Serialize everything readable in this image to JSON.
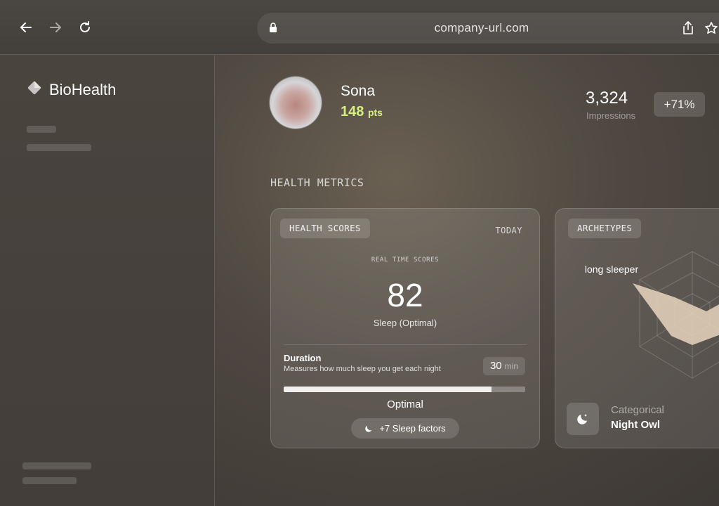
{
  "browser": {
    "url": "company-url.com",
    "icons": [
      "back-arrow-icon",
      "forward-arrow-icon",
      "reload-icon",
      "lock-icon",
      "share-icon",
      "bookmark-star-icon"
    ]
  },
  "sidebar": {
    "brand": "BioHealth",
    "logo_icon": "diamond-logo-icon"
  },
  "profile": {
    "name": "Sona",
    "points": "148",
    "points_unit": "pts",
    "impressions_value": "3,324",
    "impressions_label": "Impressions",
    "change": "+71%"
  },
  "section_title": "HEALTH METRICS",
  "health_scores": {
    "chip": "HEALTH SCORES",
    "period": "TODAY",
    "caption": "REAL TIME SCORES",
    "score": "82",
    "score_label": "Sleep (Optimal)",
    "metric_title": "Duration",
    "metric_desc": "Measures how much sleep you get each night",
    "duration_value": "30",
    "duration_unit": "min",
    "progress_fraction": 0.86,
    "status": "Optimal",
    "factors_button": "+7 Sleep factors"
  },
  "archetypes": {
    "chip": "ARCHETYPES",
    "radar_label": "long sleeper",
    "category_label": "Categorical",
    "category_value": "Night Owl",
    "accent": "#e7d5bd"
  },
  "colors": {
    "points": "#d7ee83",
    "background": "#4f4841"
  }
}
